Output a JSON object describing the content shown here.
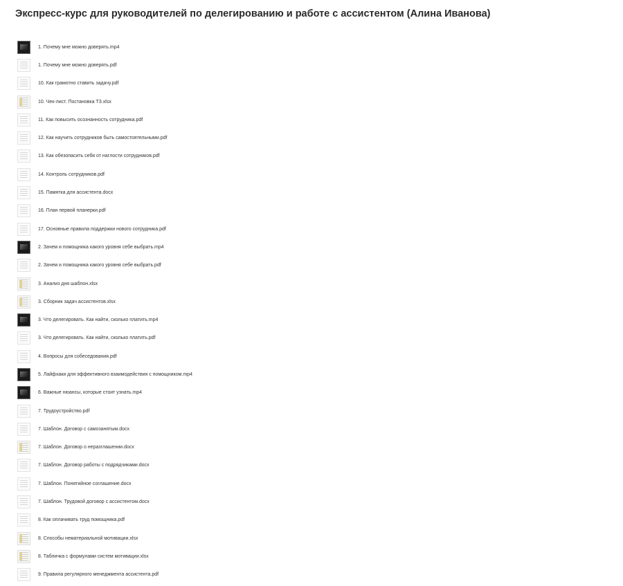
{
  "page": {
    "title": "Экспресс-курс для руководителей по делегированию и работе с ассистентом (Алина Иванова)"
  },
  "files": [
    {
      "name": "1. Почему мне можно доверять.mp4",
      "type": "video"
    },
    {
      "name": "1. Почему мне можно доверять.pdf",
      "type": "doc"
    },
    {
      "name": "10. Как грамотно ставить задачу.pdf",
      "type": "doc"
    },
    {
      "name": "10. Чек-лист. Постановка ТЗ.xlsx",
      "type": "sheet"
    },
    {
      "name": "11. Как повысить осознанность сотрудника.pdf",
      "type": "doc"
    },
    {
      "name": "12. Как научить сотрудников быть самостоятельными.pdf",
      "type": "doc"
    },
    {
      "name": "13. Как обезопасить себя от наглости сотрудников.pdf",
      "type": "doc"
    },
    {
      "name": "14. Контроль сотрудников.pdf",
      "type": "doc"
    },
    {
      "name": "15. Памятка для ассистента.docx",
      "type": "doc"
    },
    {
      "name": "16. План первой планерки.pdf",
      "type": "doc"
    },
    {
      "name": "17. Основные правила поддержки нового сотрудника.pdf",
      "type": "doc"
    },
    {
      "name": "2. Зачем и помощника какого уровня себе выбрать.mp4",
      "type": "video"
    },
    {
      "name": "2. Зачем и помощника какого уровня себе выбрать.pdf",
      "type": "doc"
    },
    {
      "name": "3. Анализ дня шаблон.xlsx",
      "type": "sheet"
    },
    {
      "name": "3. Сборник задач ассистентов.xlsx",
      "type": "sheet"
    },
    {
      "name": "3. Что делегировать. Как найти, сколько платить.mp4",
      "type": "video"
    },
    {
      "name": "3. Что делегировать. Как найти, сколько платить.pdf",
      "type": "doc"
    },
    {
      "name": "4. Вопросы для собеседования.pdf",
      "type": "doc"
    },
    {
      "name": "5. Лайфхаки для эффективного взаимодействия с помощником.mp4",
      "type": "video"
    },
    {
      "name": "6. Важные нюансы, которые стоит узнать.mp4",
      "type": "video"
    },
    {
      "name": "7. Трудоустройство.pdf",
      "type": "doc"
    },
    {
      "name": "7. Шаблон. Договор с самозанятым.docx",
      "type": "doc"
    },
    {
      "name": "7. Шаблон. Договор о неразглашении.docx",
      "type": "sheet"
    },
    {
      "name": "7. Шаблон. Договор работы с подрядчиками.docx",
      "type": "doc"
    },
    {
      "name": "7. Шаблон. Понятийное соглашение.docx",
      "type": "doc"
    },
    {
      "name": "7. Шаблон. Трудовой договор с ассистентом.docx",
      "type": "doc"
    },
    {
      "name": "8. Как оплачивать труд помощника.pdf",
      "type": "doc"
    },
    {
      "name": "8. Способы нематериальной мотивации.xlsx",
      "type": "sheet"
    },
    {
      "name": "8. Табличка с формулами систем мотивации.xlsx",
      "type": "sheet"
    },
    {
      "name": "9. Правила регулярного менеджмента ассистента.pdf",
      "type": "doc"
    }
  ]
}
